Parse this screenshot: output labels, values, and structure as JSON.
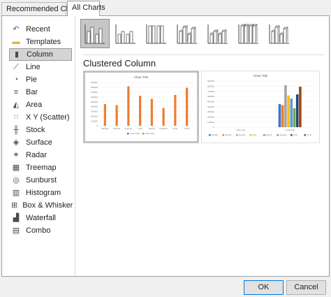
{
  "tabs": [
    {
      "label": "Recommended Charts",
      "active": false
    },
    {
      "label": "All Charts",
      "active": true
    }
  ],
  "categories": [
    {
      "label": "Recent",
      "icon": "recent-icon"
    },
    {
      "label": "Templates",
      "icon": "folder-icon"
    },
    {
      "label": "Column",
      "icon": "column-chart-icon",
      "selected": true
    },
    {
      "label": "Line",
      "icon": "line-chart-icon"
    },
    {
      "label": "Pie",
      "icon": "pie-chart-icon"
    },
    {
      "label": "Bar",
      "icon": "bar-chart-icon"
    },
    {
      "label": "Area",
      "icon": "area-chart-icon"
    },
    {
      "label": "X Y (Scatter)",
      "icon": "scatter-chart-icon"
    },
    {
      "label": "Stock",
      "icon": "stock-chart-icon"
    },
    {
      "label": "Surface",
      "icon": "surface-chart-icon"
    },
    {
      "label": "Radar",
      "icon": "radar-chart-icon"
    },
    {
      "label": "Treemap",
      "icon": "treemap-chart-icon"
    },
    {
      "label": "Sunburst",
      "icon": "sunburst-chart-icon"
    },
    {
      "label": "Histogram",
      "icon": "histogram-chart-icon"
    },
    {
      "label": "Box & Whisker",
      "icon": "box-whisker-chart-icon"
    },
    {
      "label": "Waterfall",
      "icon": "waterfall-chart-icon"
    },
    {
      "label": "Combo",
      "icon": "combo-chart-icon"
    }
  ],
  "subtypes": [
    {
      "name": "clustered-column",
      "selected": true
    },
    {
      "name": "stacked-column"
    },
    {
      "name": "100-stacked-column"
    },
    {
      "name": "3d-clustered-column"
    },
    {
      "name": "3d-stacked-column"
    },
    {
      "name": "3d-100-stacked-column"
    },
    {
      "name": "3d-column"
    }
  ],
  "selected_subtype_label": "Clustered Column",
  "previews": [
    {
      "title": "Chart Title",
      "legend": [
        "Units Sold",
        "Total Sale"
      ],
      "yticks": [
        "900000",
        "800000",
        "700000",
        "600000",
        "500000",
        "400000",
        "300000",
        "200000",
        "100000",
        "0"
      ],
      "categories": [
        "Michael",
        "Daniele",
        "Sveinde",
        "Lalia",
        "Rachel",
        "Hassard",
        "Andy",
        "Torrill"
      ],
      "values": [
        450000,
        430000,
        820000,
        620000,
        560000,
        370000,
        640000,
        790000
      ],
      "bar_color": "#ed7d31"
    },
    {
      "title": "Chart Title",
      "legend": [
        "Michael",
        "Daniele",
        "Sveinde",
        "Lalia",
        "Rachel",
        "Hassard",
        "Andy",
        "Torrill"
      ],
      "yticks": [
        "900000",
        "800000",
        "700000",
        "600000",
        "500000",
        "400000",
        "300000",
        "200000",
        "100000",
        "0"
      ],
      "groups": [
        "Units Sold",
        "Total Sale"
      ],
      "values": [
        450000,
        430000,
        820000,
        620000,
        560000,
        370000,
        640000,
        790000
      ],
      "colors": [
        "#4472c4",
        "#ed7d31",
        "#a5a5a5",
        "#ffc000",
        "#5b9bd5",
        "#70ad47",
        "#264478",
        "#9e480e"
      ]
    }
  ],
  "buttons": {
    "ok": "OK",
    "cancel": "Cancel"
  }
}
